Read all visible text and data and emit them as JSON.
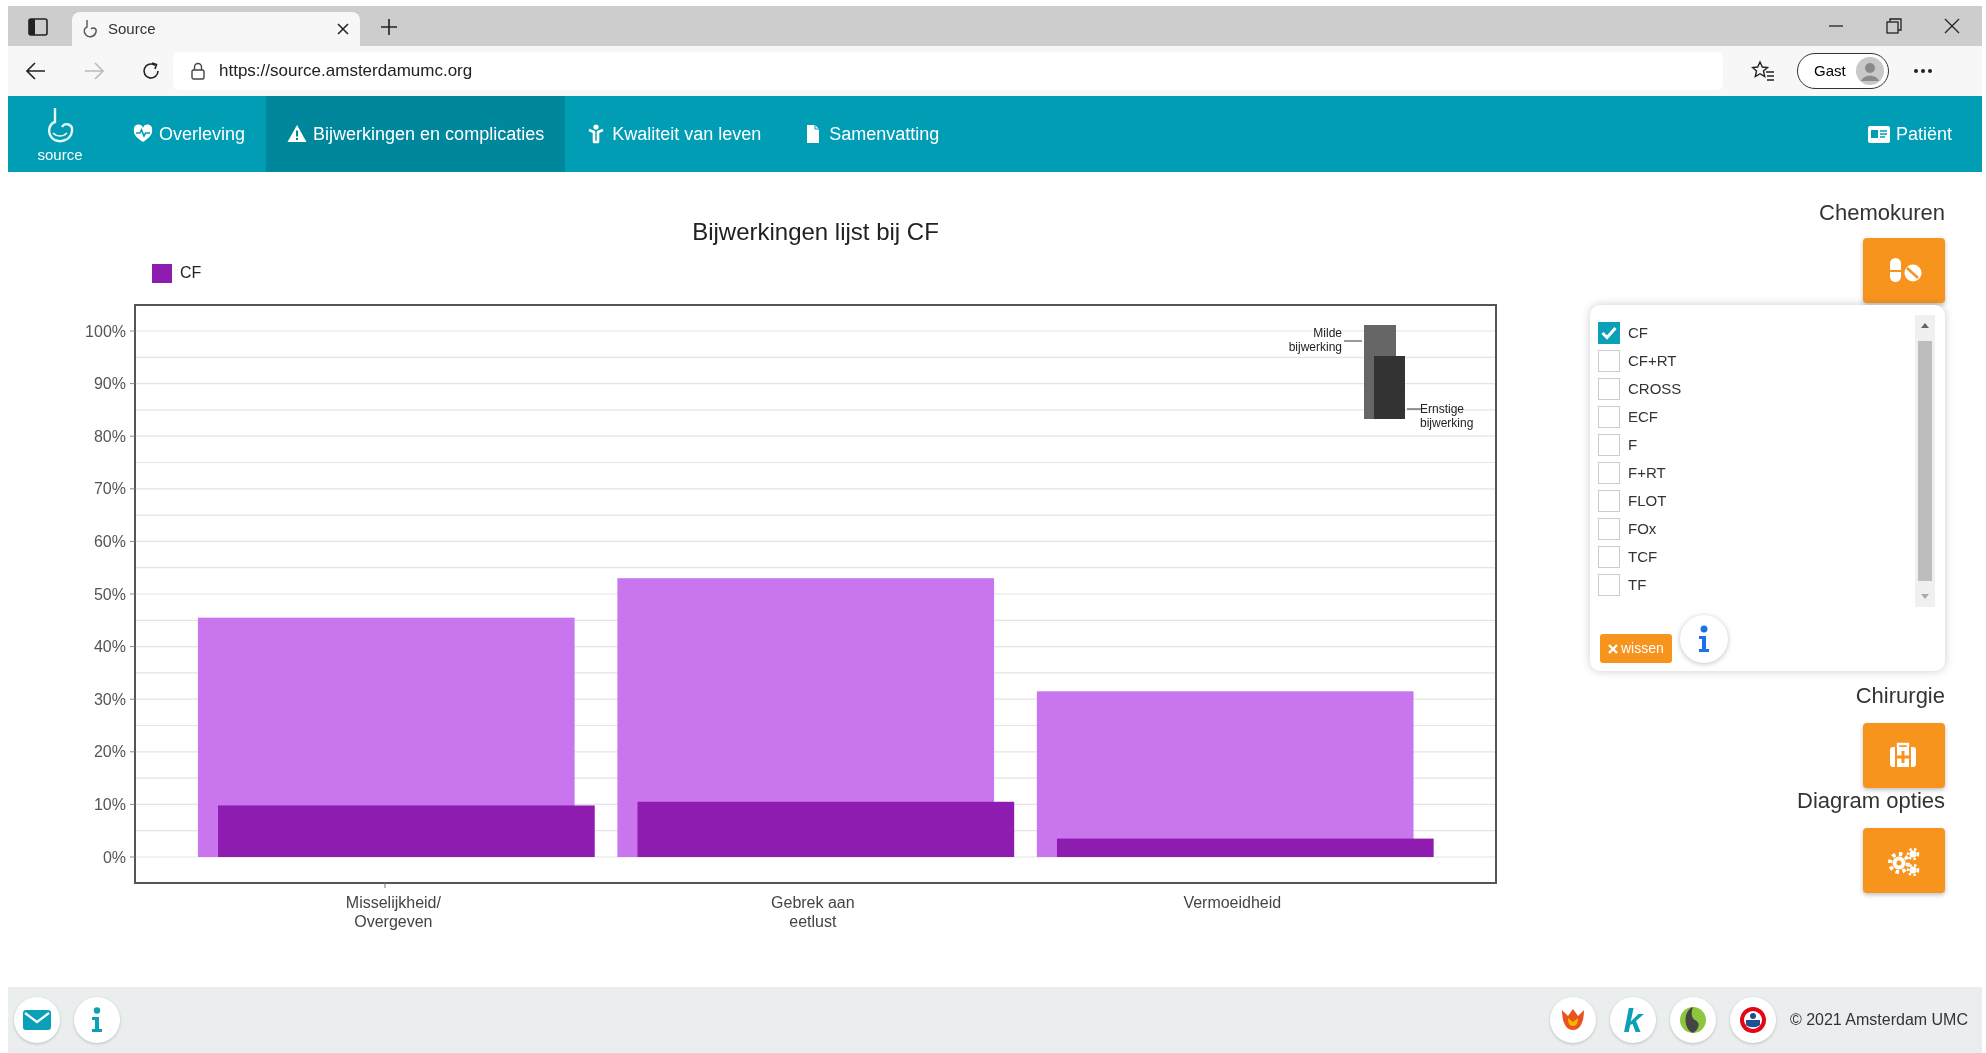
{
  "browser": {
    "tab_title": "Source",
    "url": "https://source.amsterdamumc.org",
    "profile": "Gast"
  },
  "navbar": {
    "logo_text": "source",
    "items": [
      {
        "label": "Overleving",
        "kind": "heart",
        "selected": false
      },
      {
        "label": "Bijwerkingen en complicaties",
        "kind": "warning",
        "selected": true
      },
      {
        "label": "Kwaliteit van leven",
        "kind": "person",
        "selected": false
      },
      {
        "label": "Samenvatting",
        "kind": "file",
        "selected": false
      }
    ],
    "patient_link": "Patiënt"
  },
  "chart": {
    "legend": {
      "label": "CF",
      "color": "#8e1cb0"
    },
    "chart_data": {
      "type": "bar",
      "title": "Bijwerkingen lijst bij CF",
      "categories": [
        "Misselijkheid/ Overgeven",
        "Gebrek aan eetlust",
        "Vermoeidheid"
      ],
      "series": [
        {
          "name": "Milde bijwerking",
          "color": "#c875ee",
          "values": [
            45.5,
            53,
            31.5
          ]
        },
        {
          "name": "Ernstige bijwerking",
          "color": "#8e1cb0",
          "values": [
            9.8,
            10.5,
            3.5
          ]
        }
      ],
      "ylim": [
        0,
        100
      ],
      "grid": true,
      "yticks": [
        {
          "value": 0,
          "label": "0%"
        },
        {
          "value": 10,
          "label": "10%"
        },
        {
          "value": 20,
          "label": "20%"
        },
        {
          "value": 30,
          "label": "30%"
        },
        {
          "value": 40,
          "label": "40%"
        },
        {
          "value": 50,
          "label": "50%"
        },
        {
          "value": 60,
          "label": "60%"
        },
        {
          "value": 70,
          "label": "70%"
        },
        {
          "value": 80,
          "label": "80%"
        },
        {
          "value": 90,
          "label": "90%"
        },
        {
          "value": 100,
          "label": "100%"
        }
      ]
    }
  },
  "side_panel": {
    "sections": [
      {
        "title": "Chemokuren",
        "kind": "pills"
      },
      {
        "title": "Chirurgie",
        "kind": "medkit"
      },
      {
        "title": "Diagram opties",
        "kind": "gears"
      }
    ],
    "popup": {
      "options": [
        {
          "label": "CF",
          "checked": true
        },
        {
          "label": "CF+RT",
          "checked": false
        },
        {
          "label": "CROSS",
          "checked": false
        },
        {
          "label": "ECF",
          "checked": false
        },
        {
          "label": "F",
          "checked": false
        },
        {
          "label": "F+RT",
          "checked": false
        },
        {
          "label": "FLOT",
          "checked": false
        },
        {
          "label": "FOx",
          "checked": false
        },
        {
          "label": "TCF",
          "checked": false
        },
        {
          "label": "TF",
          "checked": false
        }
      ],
      "clear_button": "wissen"
    }
  },
  "footer": {
    "partner_logos": [
      {
        "kind": "tulip"
      },
      {
        "kind": "letter",
        "text": "k"
      },
      {
        "kind": "leaf"
      },
      {
        "kind": "flag"
      }
    ],
    "copyright": "© 2021 Amsterdam UMC"
  }
}
